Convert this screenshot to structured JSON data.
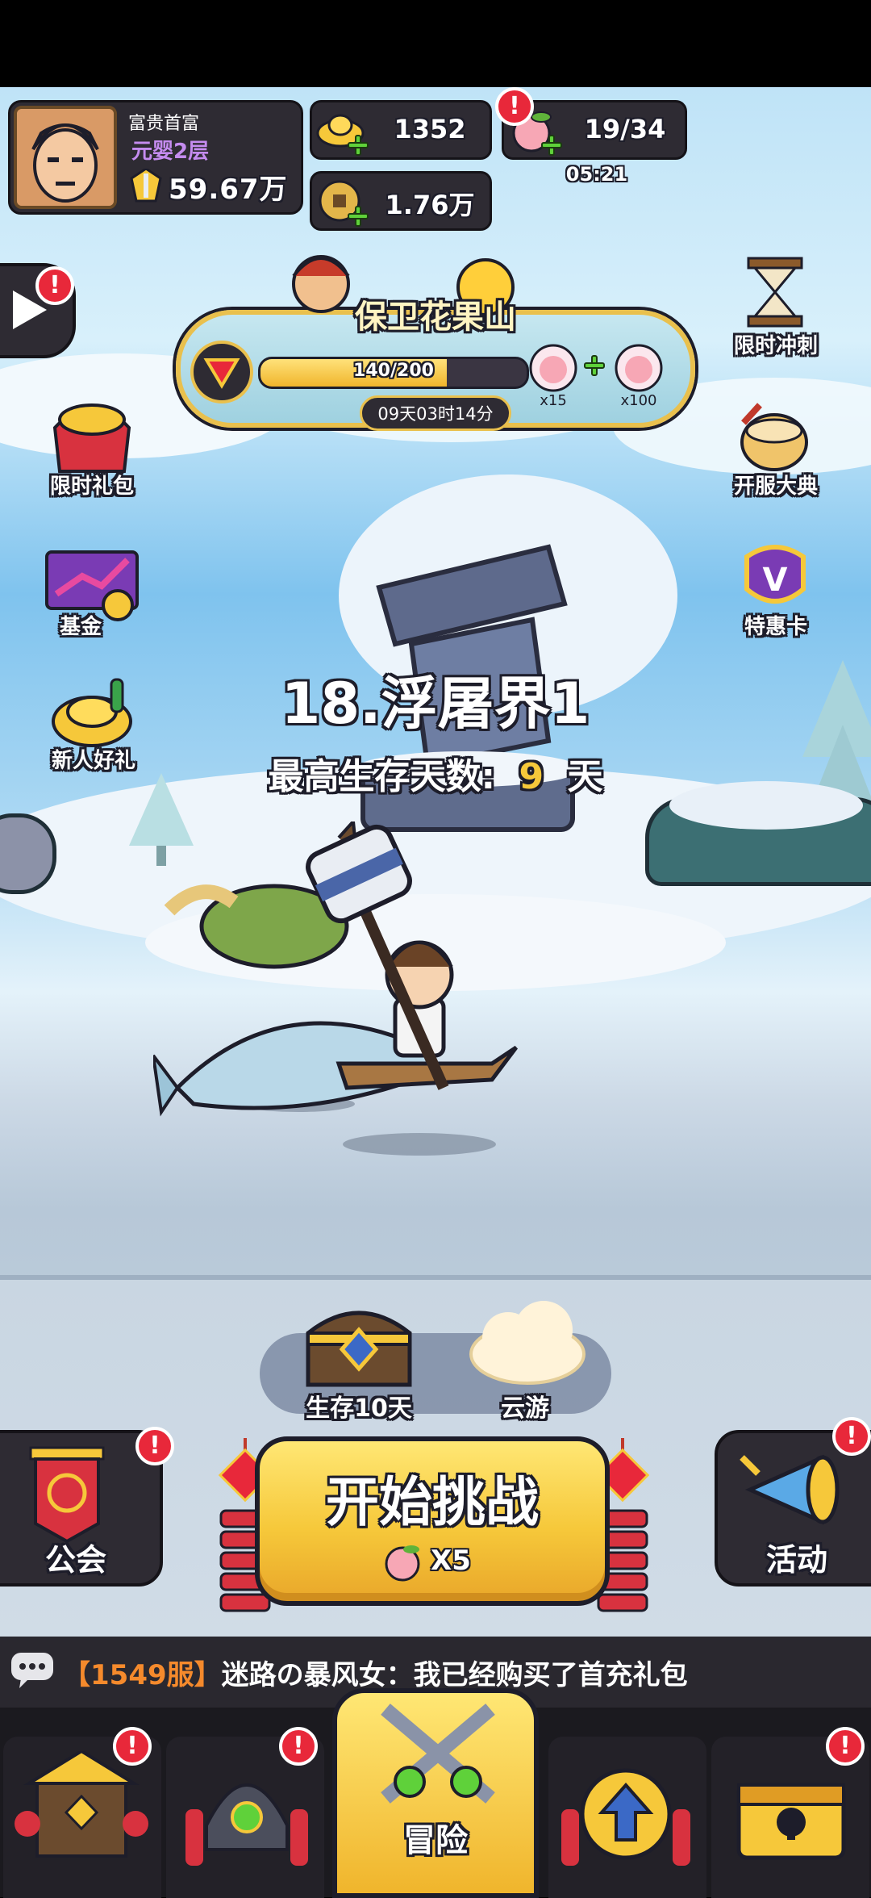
{
  "player": {
    "name": "富贵首富",
    "realm": "元婴2层",
    "power": "59.67万"
  },
  "currency": {
    "gold_ingot": "1352",
    "coins": "1.76万",
    "stamina": "19/34",
    "stamina_timer": "05:21"
  },
  "event_banner": {
    "title": "保卫花果山",
    "progress": "140/200",
    "progress_fraction": 0.7,
    "reward_left_qty": "x15",
    "reward_right_qty": "x100",
    "countdown": "09天03时14分"
  },
  "left_side": [
    {
      "label": "限时礼包",
      "icon": "gift-bag-icon"
    },
    {
      "label": "基金",
      "icon": "fund-chart-icon"
    },
    {
      "label": "新人好礼",
      "icon": "newbie-gift-icon"
    }
  ],
  "right_side": [
    {
      "label": "限时冲刺",
      "icon": "hourglass-icon"
    },
    {
      "label": "开服大典",
      "icon": "drum-icon"
    },
    {
      "label": "特惠卡",
      "icon": "vip-card-icon"
    }
  ],
  "stage": {
    "title": "18.浮屠界1",
    "best_prefix": "最高生存天数:",
    "best_value": "9",
    "best_unit": "天"
  },
  "rewards": {
    "chest_label": "生存10天",
    "cloud_label": "云游"
  },
  "actions": {
    "guild_label": "公会",
    "start_label": "开始挑战",
    "start_cost": "X5",
    "activity_label": "活动"
  },
  "chat": {
    "server": "【1549服】",
    "message": "迷路の暴风女：我已经购买了首充礼包"
  },
  "nav": {
    "center_label": "冒险"
  },
  "colors": {
    "accent_gold": "#f6c83a",
    "badge_red": "#e8283a",
    "plus_green": "#5fd13a",
    "panel_dark": "#2e2b33"
  }
}
